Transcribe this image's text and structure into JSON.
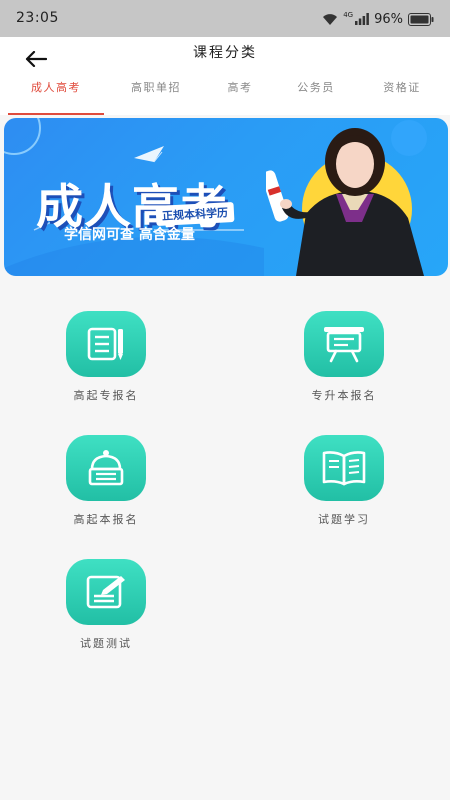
{
  "status_bar": {
    "time": "23:05",
    "network": "4G",
    "battery": "96%"
  },
  "header": {
    "title": "课程分类"
  },
  "tabs": [
    {
      "label": "成人高考",
      "active": true
    },
    {
      "label": "高职单招",
      "active": false
    },
    {
      "label": "高考",
      "active": false
    },
    {
      "label": "公务员",
      "active": false
    },
    {
      "label": "资格证",
      "active": false
    }
  ],
  "banner": {
    "title": "成人高考",
    "badge": "正规本科学历",
    "subtitle": "学信网可查 高含金量"
  },
  "grid": [
    {
      "label": "高起专报名",
      "icon": "notebook-icon"
    },
    {
      "label": "专升本报名",
      "icon": "board-icon"
    },
    {
      "label": "高起本报名",
      "icon": "bell-icon"
    },
    {
      "label": "试题学习",
      "icon": "book-icon"
    },
    {
      "label": "试题测试",
      "icon": "pencil-note-icon"
    }
  ],
  "colors": {
    "accent": "#e04b3c",
    "icon_teal": "#2acfb2",
    "banner_blue": "#2a9cf5"
  }
}
